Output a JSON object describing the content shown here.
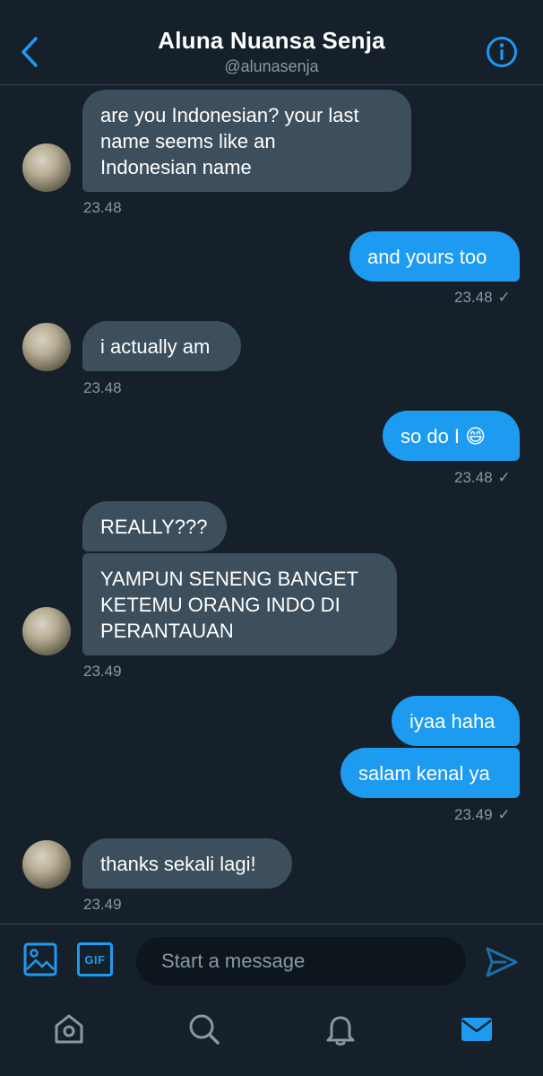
{
  "header": {
    "title": "Aluna Nuansa Senja",
    "handle": "@alunasenja"
  },
  "messages": [
    {
      "direction": "in",
      "text": "are you Indonesian? your last\nname seems like an\nIndonesian name",
      "time": "23.48"
    },
    {
      "direction": "out",
      "text": "and yours too",
      "time": "23.48"
    },
    {
      "direction": "in",
      "text": "i actually am",
      "time": "23.48"
    },
    {
      "direction": "out",
      "text": "so do I 😄",
      "time": "23.48"
    },
    {
      "direction": "in",
      "text": "REALLY???"
    },
    {
      "direction": "in",
      "text": "YAMPUN SENENG BANGET\nKETEMU ORANG INDO DI\nPERANTAUAN",
      "time": "23.49"
    },
    {
      "direction": "out",
      "text": "iyaa haha"
    },
    {
      "direction": "out",
      "text": "salam kenal ya",
      "time": "23.49"
    },
    {
      "direction": "in",
      "text": "thanks sekali lagi!",
      "time": "23.49"
    }
  ],
  "composer": {
    "placeholder": "Start a message",
    "gif_label": "GIF"
  },
  "tabs": [
    {
      "icon": "home-icon"
    },
    {
      "icon": "search-icon"
    },
    {
      "icon": "bell-icon"
    },
    {
      "icon": "mail-icon",
      "active": true
    }
  ],
  "colors": {
    "background": "#15202b",
    "accent": "#1d9bf0",
    "incoming_bubble": "#3d4f5c",
    "muted_text": "#8899a6"
  }
}
